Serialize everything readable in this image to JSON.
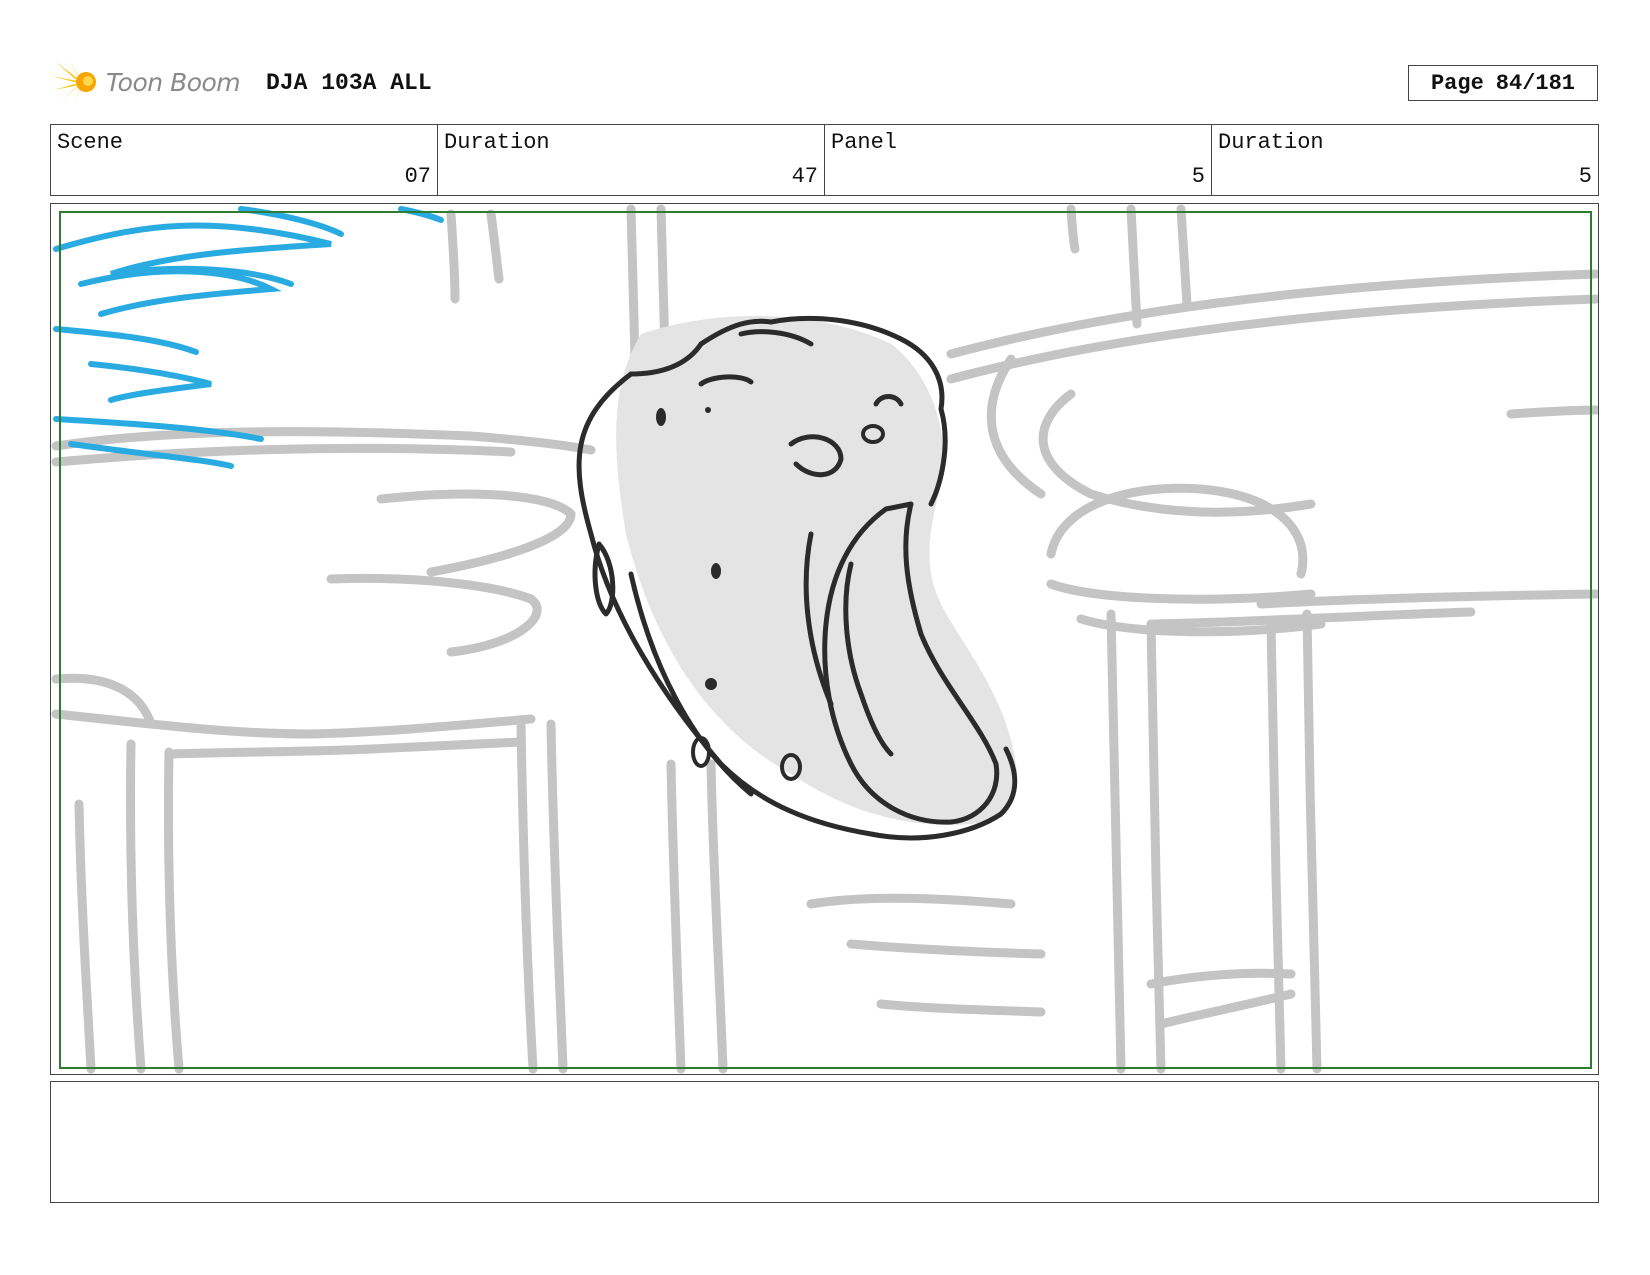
{
  "header": {
    "logo_text": "Toon Boom",
    "project_title": "DJA 103A ALL",
    "page_label": "Page",
    "page_number": "84/181"
  },
  "info": {
    "scene_label": "Scene",
    "scene_value": "07",
    "scene_duration_label": "Duration",
    "scene_duration_value": "47",
    "panel_label": "Panel",
    "panel_value": "5",
    "panel_duration_label": "Duration",
    "panel_duration_value": "5"
  },
  "colors": {
    "logo_yellow": "#F5C400",
    "safe_frame": "#2E7D32",
    "background_sketch": "#C4C4C4",
    "character_fill": "#E4E4E4",
    "character_line": "#2B2B2B",
    "accent_scribble": "#29ABE2"
  },
  "notes": {
    "text": ""
  }
}
